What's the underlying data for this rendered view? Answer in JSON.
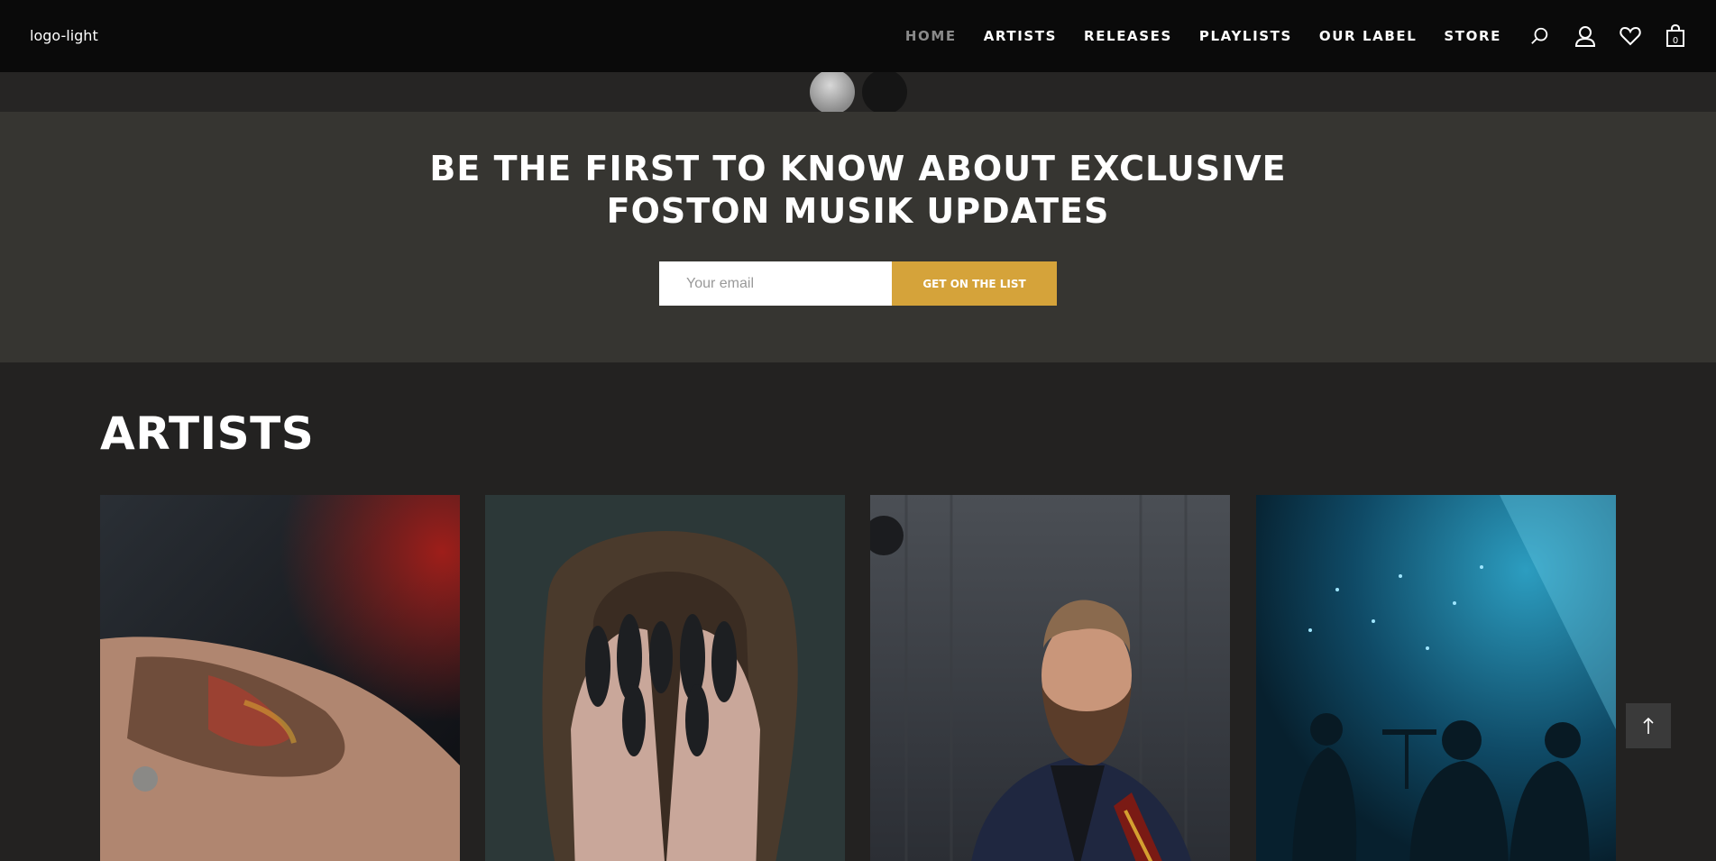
{
  "header": {
    "logo_text": "logo-light",
    "nav": [
      {
        "label": "HOME",
        "active": true
      },
      {
        "label": "ARTISTS"
      },
      {
        "label": "RELEASES"
      },
      {
        "label": "PLAYLISTS"
      },
      {
        "label": "OUR LABEL"
      },
      {
        "label": "STORE"
      }
    ],
    "icons": [
      "search-icon",
      "user-icon",
      "heart-icon",
      "shopping-bag-icon"
    ],
    "cart_count": "0"
  },
  "slider": {
    "dots": [
      "active",
      "inactive"
    ]
  },
  "newsletter": {
    "title_line_1": "BE THE FIRST TO KNOW ABOUT EXCLUSIVE",
    "title_line_2": "FOSTON MUSIK UPDATES",
    "email_placeholder": "Your email",
    "button_label": "GET ON THE LIST",
    "accent_color": "#d5a33a"
  },
  "artists": {
    "title": "ARTISTS",
    "cards": [
      {
        "image": "tattooed-hand-photo"
      },
      {
        "image": "face-covered-by-painted-hands-photo"
      },
      {
        "image": "bearded-guitarist-photo"
      },
      {
        "image": "band-on-blue-stage-photo"
      }
    ]
  },
  "back_to_top_icon": "arrow-up-icon"
}
